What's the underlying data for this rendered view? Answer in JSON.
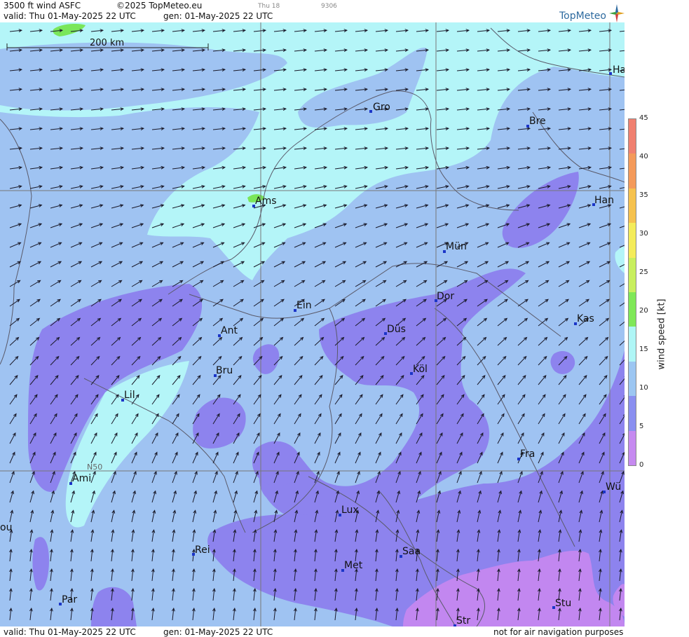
{
  "header": {
    "product": "3500 ft wind ASFC",
    "copyright": "©2025 TopMeteo.eu",
    "valid": "valid:  Thu  01-May-2025  22 UTC",
    "generated": "gen: 01-May-2025 22 UTC",
    "small_day": "Thu 18",
    "small_code": "9306",
    "logo_text": "TopMeteo"
  },
  "footer": {
    "valid": "valid:  Thu  01-May-2025  22 UTC",
    "generated": "gen: 01-May-2025 22 UTC",
    "disclaimer": "not for air navigation purposes"
  },
  "map": {
    "scale_label": "200 km",
    "latitude_label": "N50",
    "cities": [
      {
        "name": "Ha"
      },
      {
        "name": "Gro"
      },
      {
        "name": "Bre"
      },
      {
        "name": "Ams"
      },
      {
        "name": "Han"
      },
      {
        "name": "Mün"
      },
      {
        "name": "Dor"
      },
      {
        "name": "Ein"
      },
      {
        "name": "Ant"
      },
      {
        "name": "Düs"
      },
      {
        "name": "Kas"
      },
      {
        "name": "Bru"
      },
      {
        "name": "Köl"
      },
      {
        "name": "Lil"
      },
      {
        "name": "Fra"
      },
      {
        "name": "Ami"
      },
      {
        "name": "Wü"
      },
      {
        "name": "Lux"
      },
      {
        "name": "ou"
      },
      {
        "name": "Rei"
      },
      {
        "name": "Saa"
      },
      {
        "name": "Met"
      },
      {
        "name": "Par"
      },
      {
        "name": "Stu"
      },
      {
        "name": "Str"
      }
    ]
  },
  "legend": {
    "title": "wind  speed  [kt]",
    "ticks": [
      "45",
      "40",
      "35",
      "30",
      "25",
      "20",
      "15",
      "10",
      "5",
      "0"
    ],
    "colors": [
      "#f08070",
      "#f49a5a",
      "#f6c24e",
      "#f4ec5a",
      "#c8ef5e",
      "#7fe858",
      "#aff6f6",
      "#9cc6f2",
      "#8a8ff0",
      "#c68af0"
    ]
  },
  "colors": {
    "cyan_band": "#b4f5f8",
    "light_blue": "#9fc3f2",
    "medium_blue": "#8da6f3",
    "purple": "#8d83ee",
    "violet": "#c287f0",
    "green": "#7ae65a"
  }
}
